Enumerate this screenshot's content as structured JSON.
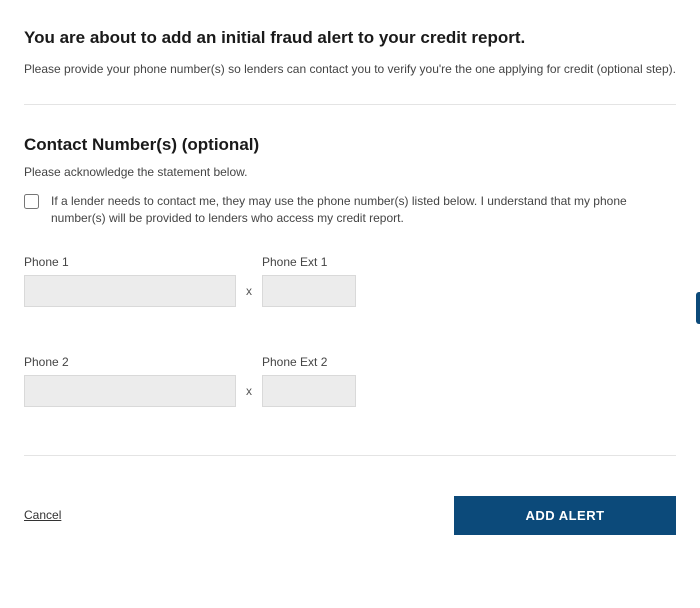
{
  "header": {
    "title": "You are about to add an initial fraud alert to your credit report.",
    "subtext": "Please provide your phone number(s) so lenders can contact you to verify you're the one applying for credit (optional step)."
  },
  "section": {
    "title": "Contact Number(s) (optional)",
    "subtext": "Please acknowledge the statement below.",
    "ack_text": "If a lender needs to contact me, they may use the phone number(s) listed below. I understand that my phone number(s) will be provided to lenders who access my credit report."
  },
  "fields": {
    "phone1_label": "Phone 1",
    "ext1_label": "Phone Ext 1",
    "phone2_label": "Phone 2",
    "ext2_label": "Phone Ext 2",
    "sep": "x"
  },
  "footer": {
    "cancel": "Cancel",
    "submit": "ADD ALERT"
  }
}
